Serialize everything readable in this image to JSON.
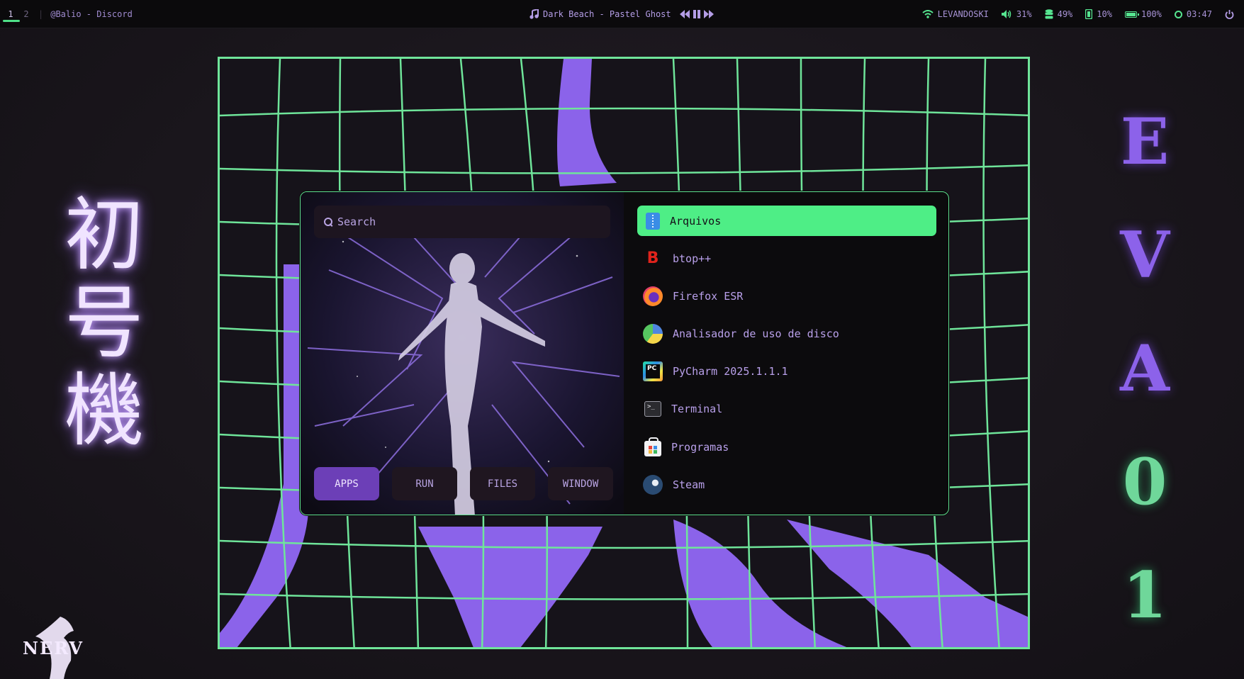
{
  "topbar": {
    "workspaces": [
      "1",
      "2"
    ],
    "active_workspace": "1",
    "window_title": "@Balio - Discord",
    "media": {
      "icon": "music-note-icon",
      "track": "Dark Beach - Pastel Ghost",
      "controls": [
        "previous",
        "pause",
        "next"
      ]
    },
    "status": {
      "wifi": {
        "icon": "wifi-icon",
        "label": "LEVANDOSKI"
      },
      "volume": {
        "icon": "volume-icon",
        "label": "31%"
      },
      "disk": {
        "icon": "database-icon",
        "label": "49%"
      },
      "memory": {
        "icon": "memory-icon",
        "label": "10%"
      },
      "battery": {
        "icon": "battery-icon",
        "label": "100%"
      },
      "clock": {
        "icon": "clock-icon",
        "label": "03:47"
      },
      "power": {
        "icon": "power-icon"
      }
    }
  },
  "wallpaper": {
    "kanji": [
      "初",
      "号",
      "機"
    ],
    "eva": [
      "E",
      "V",
      "A",
      "0",
      "1"
    ],
    "logo_text": "NERV"
  },
  "launcher": {
    "search": {
      "placeholder": "Search"
    },
    "modes": [
      "APPS",
      "RUN",
      "FILES",
      "WINDOW"
    ],
    "active_mode": "APPS",
    "apps": [
      {
        "label": "Arquivos",
        "icon": "files-icon",
        "selected": true
      },
      {
        "label": "btop++",
        "icon": "btop-icon"
      },
      {
        "label": "Firefox ESR",
        "icon": "firefox-icon"
      },
      {
        "label": "Analisador de uso de disco",
        "icon": "disk-usage-icon"
      },
      {
        "label": "PyCharm 2025.1.1.1",
        "icon": "pycharm-icon"
      },
      {
        "label": "Terminal",
        "icon": "terminal-icon"
      },
      {
        "label": "Programas",
        "icon": "software-store-icon"
      },
      {
        "label": "Steam",
        "icon": "steam-icon"
      }
    ]
  },
  "colors": {
    "accent_green": "#4eee86",
    "accent_purple": "#8c62ea",
    "text_purple": "#b9a0ea",
    "background": "#0c0b0d"
  }
}
